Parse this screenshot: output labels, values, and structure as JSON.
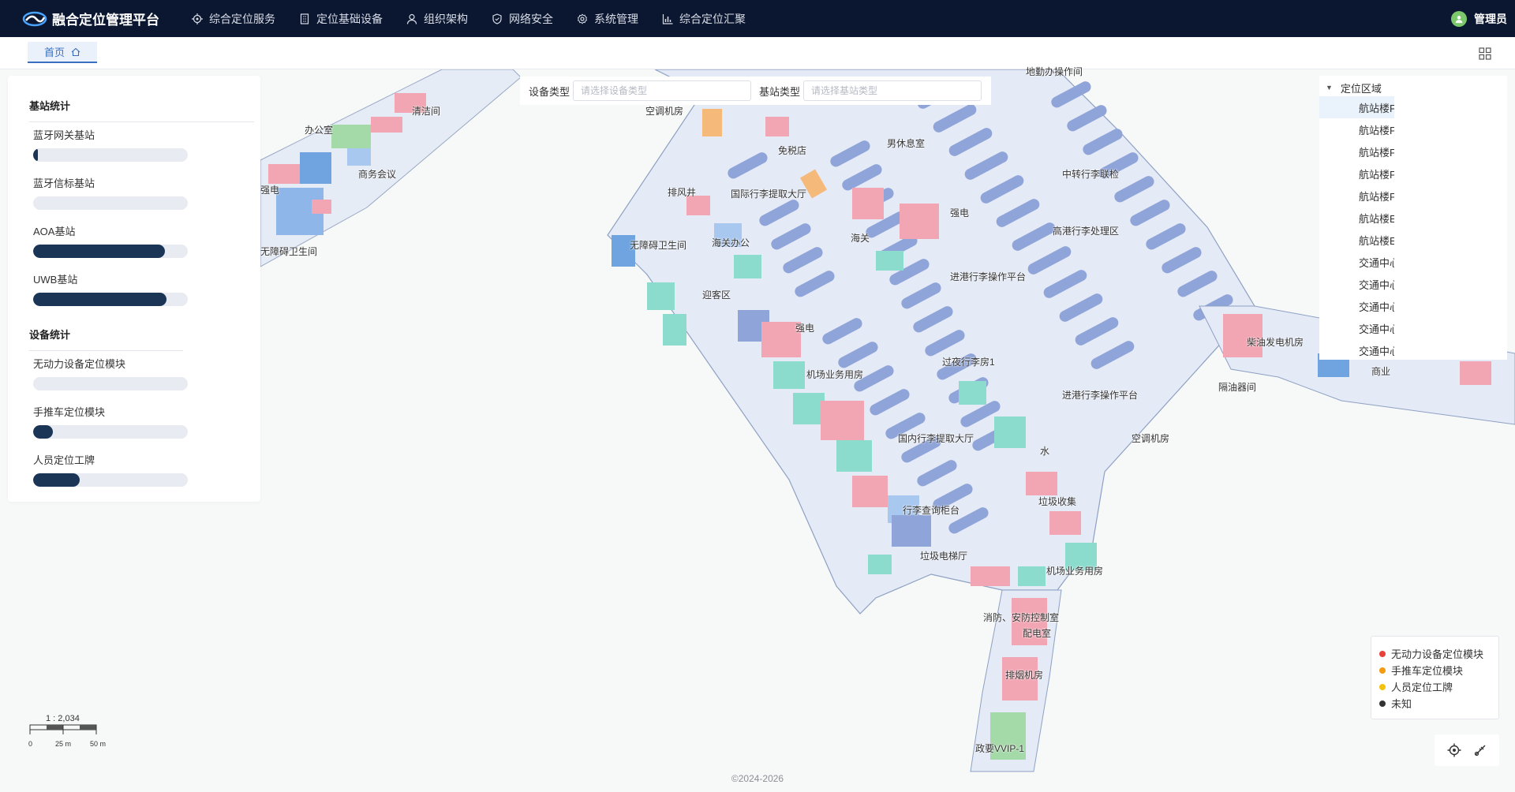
{
  "app": {
    "title": "融合定位管理平台",
    "user": "管理员"
  },
  "nav": [
    {
      "label": "综合定位服务",
      "icon": "location-target-icon"
    },
    {
      "label": "定位基础设备",
      "icon": "building-icon"
    },
    {
      "label": "组织架构",
      "icon": "user-icon"
    },
    {
      "label": "网络安全",
      "icon": "shield-icon"
    },
    {
      "label": "系统管理",
      "icon": "gear-icon"
    },
    {
      "label": "综合定位汇聚",
      "icon": "bar-chart-icon"
    }
  ],
  "tabs": {
    "home": "首页"
  },
  "stats": {
    "base_station_title": "基站统计",
    "device_title": "设备统计",
    "base_stations": [
      {
        "label": "蓝牙网关基站",
        "fraction": 0.03
      },
      {
        "label": "蓝牙信标基站",
        "fraction": 0.0
      },
      {
        "label": "AOA基站",
        "fraction": 0.85
      },
      {
        "label": "UWB基站",
        "fraction": 0.86
      }
    ],
    "devices": [
      {
        "label": "无动力设备定位模块",
        "fraction": 0.0
      },
      {
        "label": "手推车定位模块",
        "fraction": 0.13
      },
      {
        "label": "人员定位工牌",
        "fraction": 0.3
      }
    ]
  },
  "filter": {
    "device_type_label": "设备类型",
    "device_type_placeholder": "请选择设备类型",
    "station_type_label": "基站类型",
    "station_type_placeholder": "请选择基站类型"
  },
  "tree": {
    "root": "定位区域",
    "items": [
      "航站楼F",
      "航站楼F",
      "航站楼F",
      "航站楼F",
      "航站楼F",
      "航站楼E",
      "航站楼E",
      "交通中心",
      "交通中心",
      "交通中心",
      "交通中心",
      "交通中心"
    ]
  },
  "legend": [
    {
      "label": "无动力设备定位模块",
      "color": "#e8403a"
    },
    {
      "label": "手推车定位模块",
      "color": "#f39c12"
    },
    {
      "label": "人员定位工牌",
      "color": "#f4c20d"
    },
    {
      "label": "未知",
      "color": "#333333"
    }
  ],
  "map_labels": [
    "办公室",
    "清洁间",
    "商务会议",
    "强电",
    "无障碍卫生间",
    "空调机房",
    "免税店",
    "男休息室",
    "中转行李联检",
    "排风井",
    "国际行李提取大厅",
    "海关",
    "高港行李处理区",
    "无障碍卫生间",
    "海关办公",
    "强电",
    "进港行李操作平台",
    "迎客区",
    "强电",
    "过夜行李房1",
    "机场业务用房",
    "柴油发电机房",
    "进港行李操作平台",
    "隔油器间",
    "国内行李提取大厅",
    "水",
    "空调机房",
    "行李查询柜台",
    "垃圾收集",
    "垃圾电梯厅",
    "机场业务用房",
    "消防、安防控制室",
    "配电室",
    "排烟机房",
    "政要VVIP-1",
    "地勤办操作间",
    "商业"
  ],
  "scale": {
    "ratio": "1 : 2,034",
    "ticks": [
      "0",
      "25 m",
      "50 m"
    ]
  },
  "footer": "©2024-2026"
}
